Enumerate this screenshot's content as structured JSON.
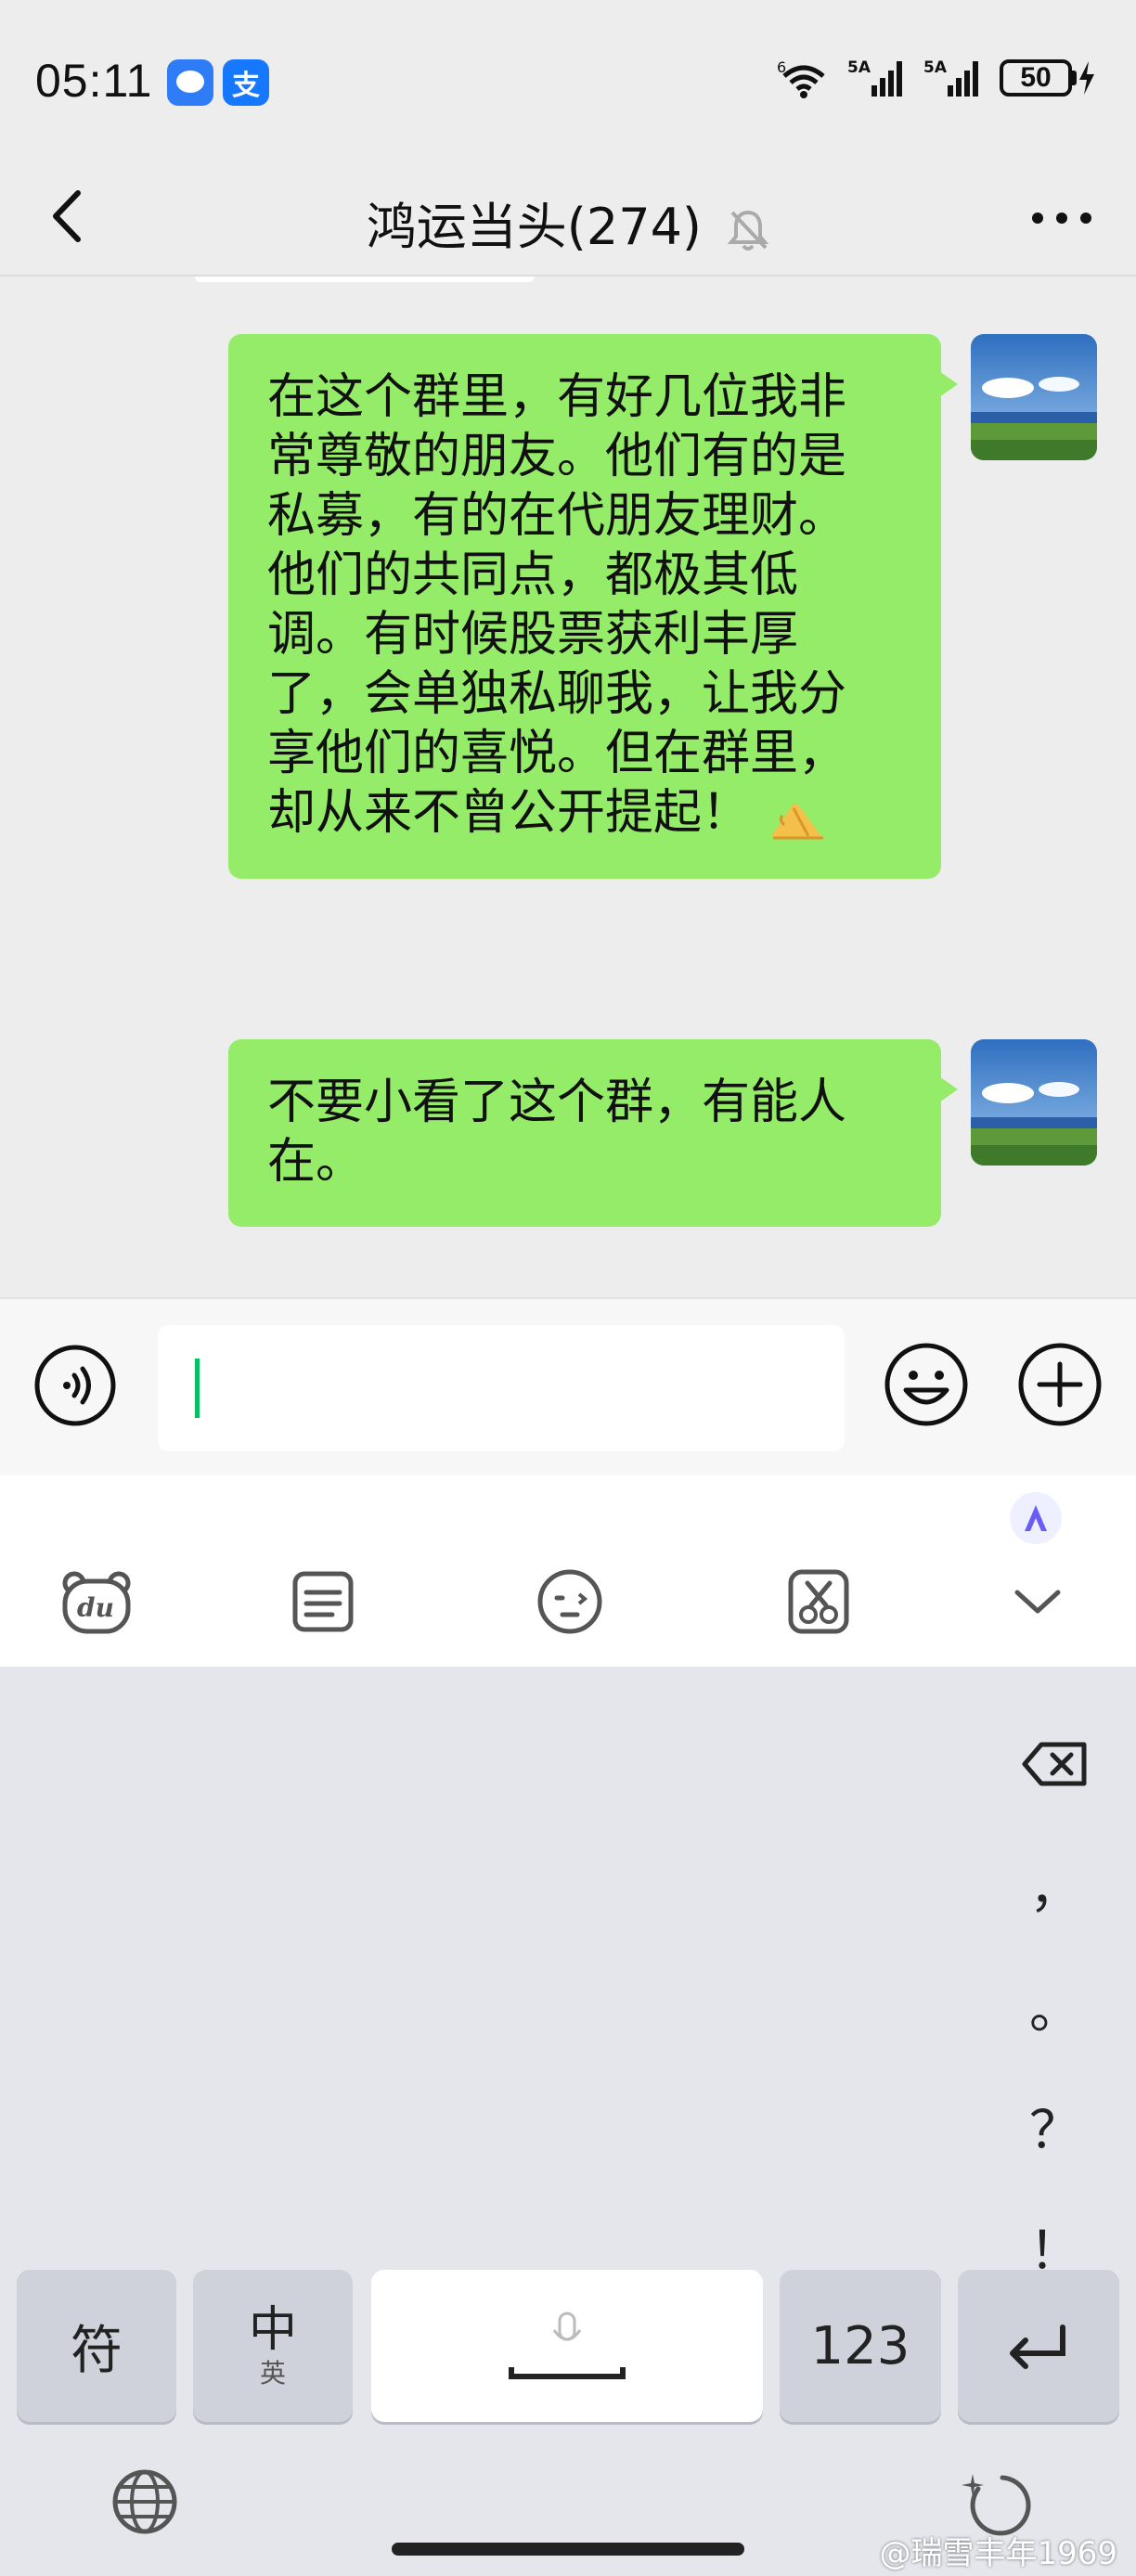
{
  "status_bar": {
    "time": "05:11",
    "battery": "50",
    "network_1": "5A",
    "network_2": "5A",
    "wifi_label": "6",
    "pay_badge": "支"
  },
  "nav": {
    "title": "鸿运当头(274)"
  },
  "messages": [
    {
      "sender": "self",
      "text": "在这个群里，有好几位我非常尊敬的朋友。他们有的是私募，有的在代朋友理财。他们的共同点，都极其低调。有时候股票获利丰厚了，会单独私聊我，让我分享他们的喜悦。但在群里，却从来不曾公开提起！",
      "lines": [
        "在这个群里，有好几位我非",
        "常尊敬的朋友。他们有的是",
        "私募，有的在代朋友理财。",
        "他们的共同点，都极其低",
        "调。有时候股票获利丰厚",
        "了，会单独私聊我，让我分",
        "享他们的喜悦。但在群里，",
        "却从来不曾公开提起！"
      ],
      "trailing_icon": "praying-hands-emoji"
    },
    {
      "sender": "self",
      "text": "不要小看了这个群，有能人在。",
      "lines": [
        "不要小看了这个群，有能人",
        "在。"
      ]
    }
  ],
  "keyboard": {
    "side_keys": [
      "，",
      "。",
      "？",
      "！"
    ],
    "key_symbols": "符",
    "key_lang_main": "中",
    "key_lang_sub": "英",
    "key_numbers": "123",
    "toolbar_icons": [
      "du-bear-icon",
      "clipboard-icon",
      "emoji-face-icon",
      "scissors-icon",
      "collapse-icon"
    ]
  },
  "watermark": "@瑞雪丰年1969",
  "colors": {
    "bubble": "#95ec69",
    "background": "#ededed",
    "caret": "#07c160"
  }
}
